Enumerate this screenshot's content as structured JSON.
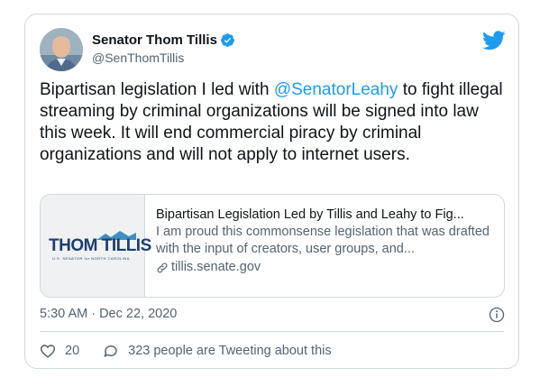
{
  "author": {
    "display_name": "Senator Thom Tillis",
    "handle": "@SenThomTillis"
  },
  "tweet": {
    "text_part1": "Bipartisan legislation I led with ",
    "mention": "@SenatorLeahy",
    "text_part2": " to fight illegal streaming by criminal organizations will be signed into law this week. It will end commercial piracy by criminal organizations and will not apply to internet users.",
    "timestamp": "5:30 AM · Dec 22, 2020"
  },
  "link_card": {
    "logo_text": "THOM TILLIS",
    "logo_subtext": "U.S. SENATOR for NORTH CAROLINA",
    "title": "Bipartisan Legislation Led by Tillis and Leahy to Fig...",
    "description": "I am proud this commonsense legislation that was drafted with the input of creators, user groups, and...",
    "domain": "tillis.senate.gov"
  },
  "actions": {
    "like_count": "20",
    "retweet_text": "323 people are Tweeting about this"
  },
  "colors": {
    "accent": "#1d9bf0",
    "muted": "#536471",
    "border": "#cfd9de",
    "logo_blue": "#1d3f6e"
  },
  "icons": [
    "verified-badge-icon",
    "twitter-bird-icon",
    "link-icon",
    "info-icon",
    "heart-icon",
    "speech-bubble-icon"
  ]
}
